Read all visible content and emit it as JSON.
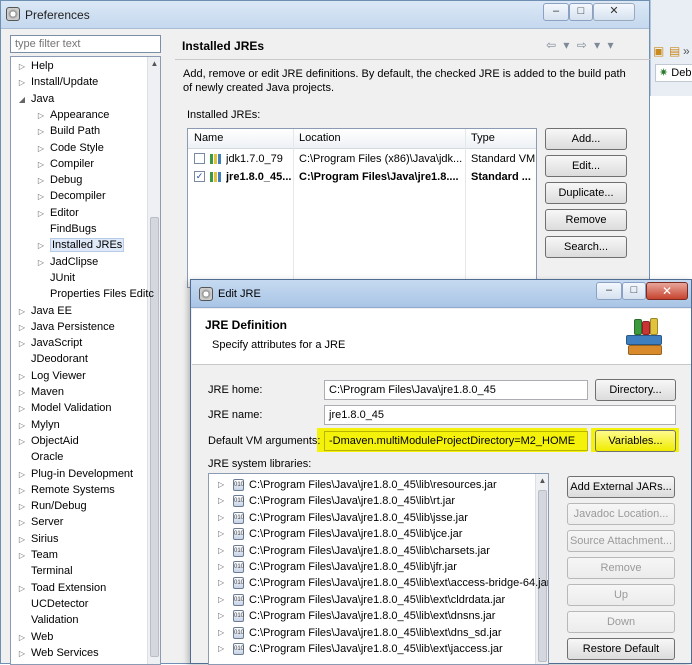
{
  "window": {
    "title": "Preferences",
    "min_symbol": "–",
    "max_symbol": "□",
    "close_symbol": "✕"
  },
  "background_app": {
    "tab_label": "Deb"
  },
  "filter": {
    "placeholder": "type filter text"
  },
  "tree": {
    "items": [
      {
        "label": "Help",
        "arrow": "▷",
        "level": 0
      },
      {
        "label": "Install/Update",
        "arrow": "▷",
        "level": 0
      },
      {
        "label": "Java",
        "arrow": "◢",
        "level": 0
      },
      {
        "label": "Appearance",
        "arrow": "▷",
        "level": 1
      },
      {
        "label": "Build Path",
        "arrow": "▷",
        "level": 1
      },
      {
        "label": "Code Style",
        "arrow": "▷",
        "level": 1
      },
      {
        "label": "Compiler",
        "arrow": "▷",
        "level": 1
      },
      {
        "label": "Debug",
        "arrow": "▷",
        "level": 1
      },
      {
        "label": "Decompiler",
        "arrow": "▷",
        "level": 1
      },
      {
        "label": "Editor",
        "arrow": "▷",
        "level": 1
      },
      {
        "label": "FindBugs",
        "arrow": "",
        "level": 1
      },
      {
        "label": "Installed JREs",
        "arrow": "▷",
        "level": 1,
        "selected": true
      },
      {
        "label": "JadClipse",
        "arrow": "▷",
        "level": 1
      },
      {
        "label": "JUnit",
        "arrow": "",
        "level": 1
      },
      {
        "label": "Properties Files Editc",
        "arrow": "",
        "level": 1
      },
      {
        "label": "Java EE",
        "arrow": "▷",
        "level": 0
      },
      {
        "label": "Java Persistence",
        "arrow": "▷",
        "level": 0
      },
      {
        "label": "JavaScript",
        "arrow": "▷",
        "level": 0
      },
      {
        "label": "JDeodorant",
        "arrow": "",
        "level": 0
      },
      {
        "label": "Log Viewer",
        "arrow": "▷",
        "level": 0
      },
      {
        "label": "Maven",
        "arrow": "▷",
        "level": 0
      },
      {
        "label": "Model Validation",
        "arrow": "▷",
        "level": 0
      },
      {
        "label": "Mylyn",
        "arrow": "▷",
        "level": 0
      },
      {
        "label": "ObjectAid",
        "arrow": "▷",
        "level": 0
      },
      {
        "label": "Oracle",
        "arrow": "",
        "level": 0
      },
      {
        "label": "Plug-in Development",
        "arrow": "▷",
        "level": 0
      },
      {
        "label": "Remote Systems",
        "arrow": "▷",
        "level": 0
      },
      {
        "label": "Run/Debug",
        "arrow": "▷",
        "level": 0
      },
      {
        "label": "Server",
        "arrow": "▷",
        "level": 0
      },
      {
        "label": "Sirius",
        "arrow": "▷",
        "level": 0
      },
      {
        "label": "Team",
        "arrow": "▷",
        "level": 0
      },
      {
        "label": "Terminal",
        "arrow": "",
        "level": 0
      },
      {
        "label": "Toad Extension",
        "arrow": "▷",
        "level": 0
      },
      {
        "label": "UCDetector",
        "arrow": "",
        "level": 0
      },
      {
        "label": "Validation",
        "arrow": "",
        "level": 0
      },
      {
        "label": "Web",
        "arrow": "▷",
        "level": 0
      },
      {
        "label": "Web Services",
        "arrow": "▷",
        "level": 0
      }
    ]
  },
  "page": {
    "title": "Installed JREs",
    "nav": "⇦ ▾ ⇨ ▾ ▾",
    "description": "Add, remove or edit JRE definitions. By default, the checked JRE is added to the build path of newly created Java projects.",
    "table_label": "Installed JREs:",
    "columns": [
      "Name",
      "Location",
      "Type"
    ],
    "rows": [
      {
        "name": "jdk1.7.0_79",
        "location": "C:\\Program Files (x86)\\Java\\jdk...",
        "type": "Standard VM",
        "checked": false,
        "check_mark": ""
      },
      {
        "name": "jre1.8.0_45...",
        "location": "C:\\Program Files\\Java\\jre1.8....",
        "type": "Standard ...",
        "checked": true,
        "check_mark": "✓"
      }
    ],
    "buttons": {
      "add": "Add...",
      "edit": "Edit...",
      "duplicate": "Duplicate...",
      "remove": "Remove",
      "search": "Search..."
    }
  },
  "dialog": {
    "title": "Edit JRE",
    "min_symbol": "–",
    "max_symbol": "□",
    "close_symbol": "✕",
    "header_title": "JRE Definition",
    "header_subtitle": "Specify attributes for a JRE",
    "jre_home_label": "JRE home:",
    "jre_home_value": "C:\\Program Files\\Java\\jre1.8.0_45",
    "directory_button": "Directory...",
    "jre_name_label": "JRE name:",
    "jre_name_value": "jre1.8.0_45",
    "vm_args_label": "Default VM arguments:",
    "vm_args_value": "-Dmaven.multiModuleProjectDirectory=M2_HOME",
    "variables_button": "Variables...",
    "libs_label": "JRE system libraries:",
    "libraries": [
      "C:\\Program Files\\Java\\jre1.8.0_45\\lib\\resources.jar",
      "C:\\Program Files\\Java\\jre1.8.0_45\\lib\\rt.jar",
      "C:\\Program Files\\Java\\jre1.8.0_45\\lib\\jsse.jar",
      "C:\\Program Files\\Java\\jre1.8.0_45\\lib\\jce.jar",
      "C:\\Program Files\\Java\\jre1.8.0_45\\lib\\charsets.jar",
      "C:\\Program Files\\Java\\jre1.8.0_45\\lib\\jfr.jar",
      "C:\\Program Files\\Java\\jre1.8.0_45\\lib\\ext\\access-bridge-64.jar",
      "C:\\Program Files\\Java\\jre1.8.0_45\\lib\\ext\\cldrdata.jar",
      "C:\\Program Files\\Java\\jre1.8.0_45\\lib\\ext\\dnsns.jar",
      "C:\\Program Files\\Java\\jre1.8.0_45\\lib\\ext\\dns_sd.jar",
      "C:\\Program Files\\Java\\jre1.8.0_45\\lib\\ext\\jaccess.jar"
    ],
    "lib_buttons": {
      "add_external": "Add External JARs...",
      "javadoc": "Javadoc Location...",
      "source": "Source Attachment...",
      "remove": "Remove",
      "up": "Up",
      "down": "Down",
      "restore": "Restore Default"
    }
  },
  "colors": {
    "highlight": "#f4f20a",
    "selection": "#dfe9f7",
    "title_gradient_top": "#dbe8f6"
  }
}
